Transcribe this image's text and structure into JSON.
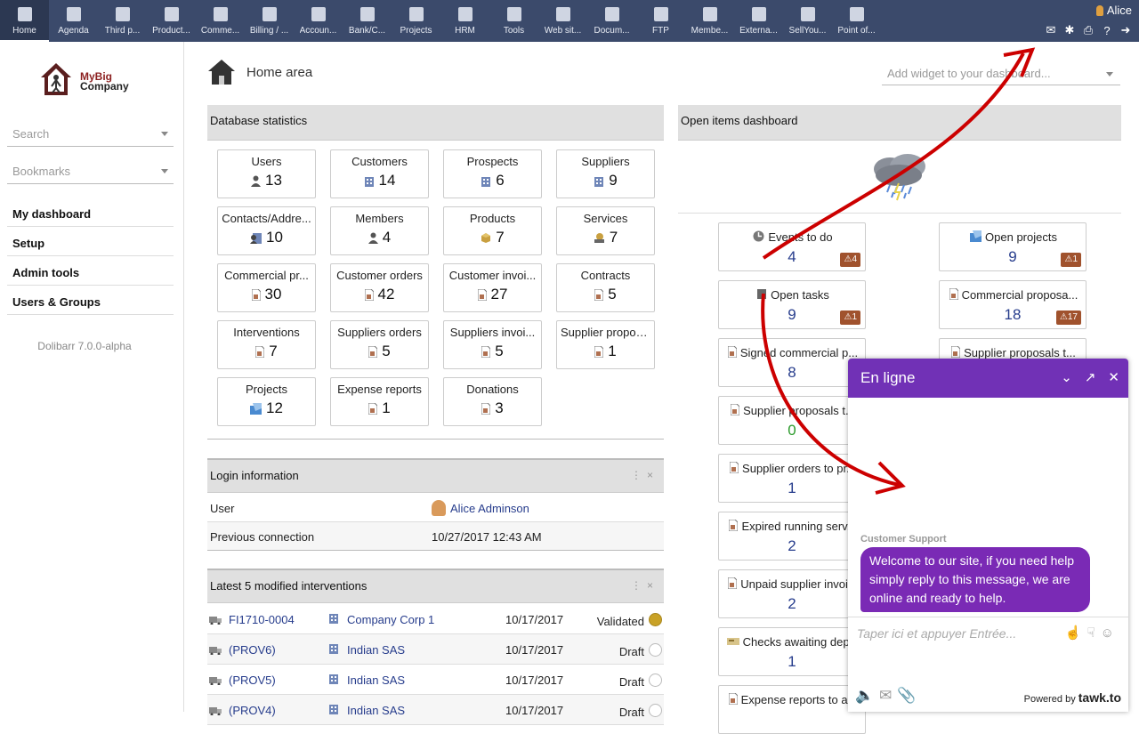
{
  "menu": [
    {
      "label": "Home",
      "icon": "home-icon",
      "active": true
    },
    {
      "label": "Agenda",
      "icon": "agenda-icon"
    },
    {
      "label": "Third p...",
      "icon": "third-party-icon"
    },
    {
      "label": "Product...",
      "icon": "product-icon"
    },
    {
      "label": "Comme...",
      "icon": "commercial-icon"
    },
    {
      "label": "Billing / ...",
      "icon": "billing-icon"
    },
    {
      "label": "Accoun...",
      "icon": "accounting-icon"
    },
    {
      "label": "Bank/C...",
      "icon": "bank-icon"
    },
    {
      "label": "Projects",
      "icon": "projects-icon"
    },
    {
      "label": "HRM",
      "icon": "hrm-icon"
    },
    {
      "label": "Tools",
      "icon": "tools-icon"
    },
    {
      "label": "Web sit...",
      "icon": "website-icon"
    },
    {
      "label": "Docum...",
      "icon": "documents-icon"
    },
    {
      "label": "FTP",
      "icon": "ftp-icon"
    },
    {
      "label": "Membe...",
      "icon": "members-icon"
    },
    {
      "label": "Externa...",
      "icon": "external-icon"
    },
    {
      "label": "SellYou...",
      "icon": "sellyoursaas-icon"
    },
    {
      "label": "Point of...",
      "icon": "point-of-sale-icon"
    }
  ],
  "user": {
    "name": "Alice"
  },
  "sidebar": {
    "logo_line1": "MyBig",
    "logo_line2": "Company",
    "search_placeholder": "Search",
    "bookmarks_placeholder": "Bookmarks",
    "nav": [
      "My dashboard",
      "Setup",
      "Admin tools",
      "Users & Groups"
    ],
    "version": "Dolibarr 7.0.0-alpha"
  },
  "page": {
    "title": "Home area",
    "widget_placeholder": "Add widget to your dashboard..."
  },
  "db_stats": {
    "title": "Database statistics",
    "items": [
      {
        "name": "Users",
        "value": "13",
        "icon": "user-icon"
      },
      {
        "name": "Customers",
        "value": "14",
        "icon": "company-icon"
      },
      {
        "name": "Prospects",
        "value": "6",
        "icon": "company-icon"
      },
      {
        "name": "Suppliers",
        "value": "9",
        "icon": "company-icon"
      },
      {
        "name": "Contacts/Addre...",
        "value": "10",
        "icon": "contact-icon"
      },
      {
        "name": "Members",
        "value": "4",
        "icon": "user-icon"
      },
      {
        "name": "Products",
        "value": "7",
        "icon": "product-icon"
      },
      {
        "name": "Services",
        "value": "7",
        "icon": "service-icon"
      },
      {
        "name": "Commercial pr...",
        "value": "30",
        "icon": "document-icon"
      },
      {
        "name": "Customer orders",
        "value": "42",
        "icon": "document-icon"
      },
      {
        "name": "Customer invoi...",
        "value": "27",
        "icon": "document-icon"
      },
      {
        "name": "Contracts",
        "value": "5",
        "icon": "document-icon"
      },
      {
        "name": "Interventions",
        "value": "7",
        "icon": "document-icon"
      },
      {
        "name": "Suppliers orders",
        "value": "5",
        "icon": "document-icon"
      },
      {
        "name": "Suppliers invoi...",
        "value": "5",
        "icon": "document-icon"
      },
      {
        "name": "Supplier proposal",
        "value": "1",
        "icon": "document-icon"
      },
      {
        "name": "Projects",
        "value": "12",
        "icon": "project-icon"
      },
      {
        "name": "Expense reports",
        "value": "1",
        "icon": "document-icon"
      },
      {
        "name": "Donations",
        "value": "3",
        "icon": "document-icon"
      }
    ]
  },
  "login": {
    "title": "Login information",
    "user_label": "User",
    "user_value": "Alice Adminson",
    "prev_label": "Previous connection",
    "prev_value": "10/27/2017 12:43 AM"
  },
  "interventions": {
    "title": "Latest 5 modified interventions",
    "rows": [
      {
        "ref": "FI1710-0004",
        "company": "Company Corp 1",
        "date": "10/17/2017",
        "status": "Validated"
      },
      {
        "ref": "(PROV6)",
        "company": "Indian SAS",
        "date": "10/17/2017",
        "status": "Draft"
      },
      {
        "ref": "(PROV5)",
        "company": "Indian SAS",
        "date": "10/17/2017",
        "status": "Draft"
      },
      {
        "ref": "(PROV4)",
        "company": "Indian SAS",
        "date": "10/17/2017",
        "status": "Draft"
      }
    ]
  },
  "open_items": {
    "title": "Open items dashboard",
    "left": [
      {
        "name": "Events to do",
        "value": "4",
        "badge": "4",
        "icon": "clock-icon"
      },
      {
        "name": "Open tasks",
        "value": "9",
        "badge": "1",
        "icon": "task-icon"
      },
      {
        "name": "Signed commercial p...",
        "value": "8",
        "icon": "document-icon"
      },
      {
        "name": "Supplier proposals t...",
        "value": "0",
        "icon": "document-icon"
      },
      {
        "name": "Supplier orders to pr...",
        "value": "1",
        "icon": "document-icon"
      },
      {
        "name": "Expired running serv...",
        "value": "2",
        "icon": "document-icon"
      },
      {
        "name": "Unpaid supplier invoi...",
        "value": "2",
        "icon": "document-icon"
      },
      {
        "name": "Checks awaiting dep...",
        "value": "1",
        "icon": "check-icon"
      },
      {
        "name": "Expense reports to a...",
        "value": "",
        "icon": "document-icon"
      }
    ],
    "right": [
      {
        "name": "Open projects",
        "value": "9",
        "badge": "1",
        "icon": "project-icon"
      },
      {
        "name": "Commercial proposa...",
        "value": "18",
        "badge": "17",
        "icon": "document-icon"
      },
      {
        "name": "Supplier proposals t...",
        "value": "",
        "icon": "document-icon"
      }
    ]
  },
  "chat": {
    "title": "En ligne",
    "agent": "Customer Support",
    "message": "Welcome to our site, if you need help simply reply to this message, we are online and ready to help.",
    "input_placeholder": "Taper ici et appuyer Entrée...",
    "powered_prefix": "Powered by",
    "powered_brand": "tawk.to"
  },
  "colors": {
    "topbar": "#3b4a6b",
    "chat": "#7131b6",
    "badge": "#a0522d",
    "link": "#263c8c",
    "annotation": "#cc0000"
  }
}
